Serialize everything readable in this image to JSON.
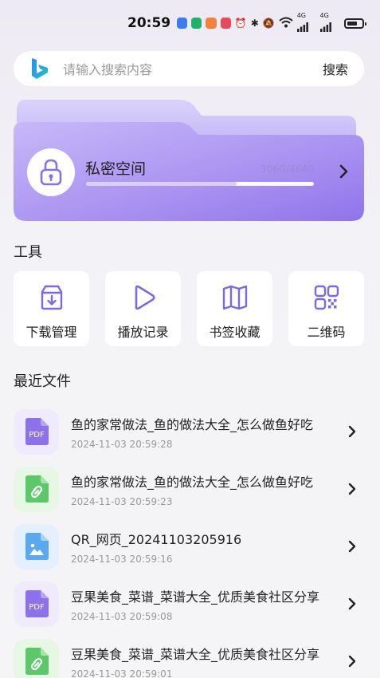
{
  "status_bar": {
    "time": "20:59",
    "network_1": "4G",
    "network_2": "4G"
  },
  "search": {
    "placeholder": "请输入搜索内容",
    "button_label": "搜索"
  },
  "private_space": {
    "title": "私密空间",
    "usage": "306G/464G",
    "used_fraction": 0.66
  },
  "tools": {
    "title": "工具",
    "items": [
      {
        "label": "下载管理",
        "icon": "download-box-icon"
      },
      {
        "label": "播放记录",
        "icon": "play-icon"
      },
      {
        "label": "书签收藏",
        "icon": "book-map-icon"
      },
      {
        "label": "二维码",
        "icon": "qr-code-icon"
      }
    ]
  },
  "recent": {
    "title": "最近文件",
    "files": [
      {
        "name": "鱼的家常做法_鱼的做法大全_怎么做鱼好吃",
        "time": "2024-11-03 20:59:28",
        "type": "pdf",
        "badge": "PDF"
      },
      {
        "name": "鱼的家常做法_鱼的做法大全_怎么做鱼好吃",
        "time": "2024-11-03 20:59:23",
        "type": "link"
      },
      {
        "name": "QR_网页_20241103205916",
        "time": "2024-11-03 20:59:16",
        "type": "image"
      },
      {
        "name": "豆果美食_菜谱_菜谱大全_优质美食社区分享",
        "time": "2024-11-03 20:59:08",
        "type": "pdf",
        "badge": "PDF"
      },
      {
        "name": "豆果美食_菜谱_菜谱大全_优质美食社区分享",
        "time": "2024-11-03 20:59:01",
        "type": "link"
      }
    ]
  },
  "colors": {
    "accent_purple": "#8b72ea",
    "pdf_bg": "#efeafc",
    "link_bg": "#e6f7e4",
    "link_green": "#5bc86a",
    "image_bg": "#e4f0fd",
    "image_blue": "#5aa9f0"
  }
}
